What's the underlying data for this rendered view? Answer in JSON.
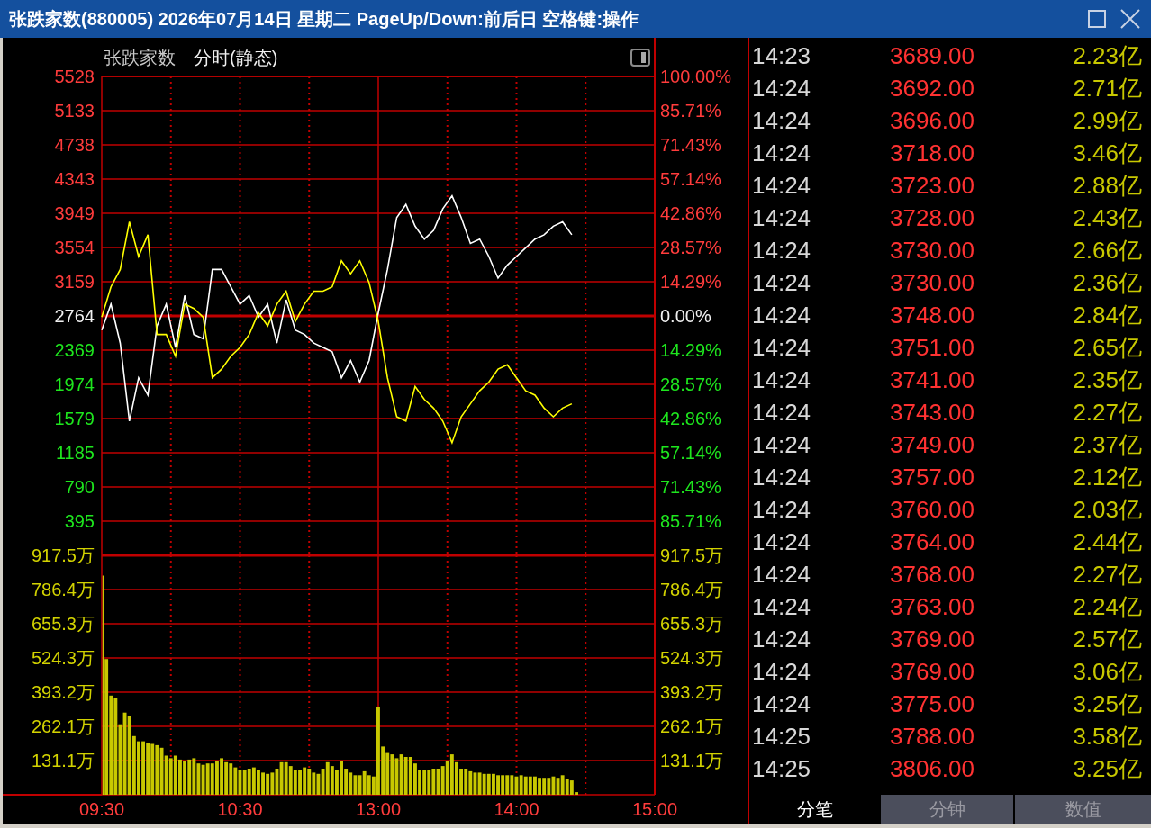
{
  "window": {
    "title": "张跌家数(880005) 2026年07月14日 星期二 PageUp/Down:前后日 空格键:操作"
  },
  "chart_panel": {
    "chart_data": [
      {
        "type": "line",
        "title": "张跌家数",
        "subtitle": "分时(静态)",
        "categories": [
          null,
          null,
          null,
          null,
          null,
          null,
          null,
          null,
          null,
          null,
          null,
          null,
          null,
          null,
          null,
          null,
          null,
          null,
          null,
          null,
          null,
          null,
          null,
          null,
          null,
          null,
          null,
          null,
          null,
          null,
          null,
          null,
          null,
          null,
          null,
          null,
          null,
          null,
          null,
          null,
          null,
          null,
          null,
          null,
          null,
          null,
          null,
          null,
          null,
          null,
          null,
          null,
          null,
          null,
          null,
          null,
          null,
          null,
          null,
          null,
          null
        ],
        "series": [
          {
            "color": "#ffffff",
            "values": [
              2600,
              2900,
              2450,
              1550,
              2050,
              1850,
              2650,
              2900,
              2400,
              3000,
              2550,
              2500,
              3300,
              3300,
              3100,
              2900,
              3000,
              2750,
              2900,
              2450,
              2950,
              2600,
              2550,
              2450,
              2400,
              2350,
              2050,
              2250,
              2000,
              2250,
              2800,
              3300,
              3900,
              4050,
              3800,
              3650,
              3750,
              4000,
              4150,
              3900,
              3600,
              3650,
              3450,
              3200,
              3350,
              3450,
              3550,
              3650,
              3700,
              3800,
              3850,
              3700,
              null,
              null,
              null,
              null,
              null,
              null,
              null,
              null,
              null
            ]
          },
          {
            "color": "#ffff00",
            "values": [
              2750,
              3100,
              3300,
              3850,
              3450,
              3700,
              2550,
              2550,
              2300,
              2900,
              2850,
              2750,
              2050,
              2150,
              2300,
              2400,
              2550,
              2800,
              2650,
              2900,
              3050,
              2700,
              2900,
              3050,
              3050,
              3100,
              3400,
              3250,
              3400,
              3150,
              2700,
              2050,
              1600,
              1550,
              1950,
              1800,
              1700,
              1550,
              1300,
              1600,
              1750,
              1900,
              2000,
              2150,
              2200,
              2050,
              1900,
              1850,
              1700,
              1600,
              1700,
              1750,
              null,
              null,
              null,
              null,
              null,
              null,
              null,
              null,
              null
            ]
          }
        ],
        "ylim": [
          0,
          5528
        ],
        "y2lim": [
          -100,
          100
        ],
        "yticks": [
          5528,
          5133,
          4738,
          4343,
          3949,
          3554,
          3159,
          2764,
          2369,
          1974,
          1579,
          1185,
          790,
          395
        ],
        "y2ticks": [
          {
            "value": 100,
            "label": "100.00%"
          },
          {
            "value": 85.71,
            "label": "85.71%"
          },
          {
            "value": 71.43,
            "label": "71.43%"
          },
          {
            "value": 57.14,
            "label": "57.14%"
          },
          {
            "value": 42.86,
            "label": "42.86%"
          },
          {
            "value": 28.57,
            "label": "28.57%"
          },
          {
            "value": 14.29,
            "label": "14.29%"
          },
          {
            "value": 0,
            "label": "0.00%"
          },
          {
            "value": -14.29,
            "label": "14.29%"
          },
          {
            "value": -28.57,
            "label": "28.57%"
          },
          {
            "value": -42.86,
            "label": "42.86%"
          },
          {
            "value": -57.14,
            "label": "57.14%"
          },
          {
            "value": -71.43,
            "label": "71.43%"
          },
          {
            "value": -85.71,
            "label": "85.71%"
          }
        ],
        "ref_lines": [
          {
            "axis": "y",
            "value": 2764
          }
        ],
        "grid": true
      },
      {
        "type": "bar",
        "categories": [
          "09:30",
          null,
          null,
          null,
          null,
          null,
          null,
          null,
          null,
          null,
          null,
          null,
          null,
          null,
          null,
          null,
          null,
          null,
          null,
          null,
          null,
          null,
          null,
          null,
          null,
          null,
          null,
          null,
          null,
          null,
          "10:30",
          null,
          null,
          null,
          null,
          null,
          null,
          null,
          null,
          null,
          null,
          null,
          null,
          null,
          null,
          null,
          null,
          null,
          null,
          null,
          null,
          null,
          null,
          null,
          null,
          null,
          null,
          null,
          null,
          null,
          "13:00",
          null,
          null,
          null,
          null,
          null,
          null,
          null,
          null,
          null,
          null,
          null,
          null,
          null,
          null,
          null,
          null,
          null,
          null,
          null,
          null,
          null,
          null,
          null,
          null,
          null,
          null,
          null,
          null,
          null,
          "14:00",
          null,
          null,
          null,
          null,
          null,
          null,
          null,
          null,
          null,
          null,
          null,
          null,
          null,
          null,
          null,
          null,
          null,
          null,
          null,
          null,
          null,
          null,
          null,
          null,
          null,
          null,
          null,
          null,
          null,
          "15:00"
        ],
        "values": [
          840,
          520,
          380,
          370,
          270,
          315,
          300,
          225,
          205,
          205,
          200,
          195,
          190,
          180,
          150,
          140,
          150,
          135,
          130,
          135,
          140,
          120,
          115,
          120,
          120,
          130,
          140,
          125,
          120,
          105,
          95,
          95,
          100,
          105,
          95,
          85,
          80,
          85,
          100,
          125,
          125,
          110,
          95,
          95,
          105,
          100,
          85,
          80,
          100,
          125,
          110,
          95,
          130,
          100,
          85,
          75,
          75,
          90,
          75,
          70,
          335,
          185,
          160,
          155,
          140,
          155,
          145,
          145,
          120,
          95,
          95,
          95,
          100,
          100,
          110,
          130,
          155,
          125,
          100,
          100,
          90,
          85,
          85,
          80,
          80,
          80,
          75,
          75,
          75,
          75,
          70,
          75,
          70,
          70,
          70,
          65,
          65,
          65,
          70,
          65,
          75,
          60,
          55,
          10,
          null,
          null,
          null,
          null,
          null,
          null,
          null,
          null,
          null,
          null,
          null,
          null,
          null,
          null,
          null,
          null,
          null
        ],
        "color": "#c8c800",
        "ylim": [
          0,
          917.5
        ],
        "y2lim": [
          0,
          917.5
        ],
        "yticks": [
          {
            "value": 917.5,
            "label": "917.5万"
          },
          {
            "value": 786.4,
            "label": "786.4万"
          },
          {
            "value": 655.3,
            "label": "655.3万"
          },
          {
            "value": 524.3,
            "label": "524.3万"
          },
          {
            "value": 393.2,
            "label": "393.2万"
          },
          {
            "value": 262.1,
            "label": "262.1万"
          },
          {
            "value": 131.1,
            "label": "131.1万"
          }
        ],
        "y2ticks": [
          {
            "value": 917.5,
            "label": "917.5万"
          },
          {
            "value": 786.4,
            "label": "786.4万"
          },
          {
            "value": 655.3,
            "label": "655.3万"
          },
          {
            "value": 524.3,
            "label": "524.3万"
          },
          {
            "value": 393.2,
            "label": "393.2万"
          },
          {
            "value": 262.1,
            "label": "262.1万"
          },
          {
            "value": 131.1,
            "label": "131.1万"
          }
        ],
        "grid": true
      }
    ]
  },
  "trades": {
    "rows": [
      {
        "time": "14:23",
        "price": "3689.00",
        "amount": "2.23亿"
      },
      {
        "time": "14:24",
        "price": "3692.00",
        "amount": "2.71亿"
      },
      {
        "time": "14:24",
        "price": "3696.00",
        "amount": "2.99亿"
      },
      {
        "time": "14:24",
        "price": "3718.00",
        "amount": "3.46亿"
      },
      {
        "time": "14:24",
        "price": "3723.00",
        "amount": "2.88亿"
      },
      {
        "time": "14:24",
        "price": "3728.00",
        "amount": "2.43亿"
      },
      {
        "time": "14:24",
        "price": "3730.00",
        "amount": "2.66亿"
      },
      {
        "time": "14:24",
        "price": "3730.00",
        "amount": "2.36亿"
      },
      {
        "time": "14:24",
        "price": "3748.00",
        "amount": "2.84亿"
      },
      {
        "time": "14:24",
        "price": "3751.00",
        "amount": "2.65亿"
      },
      {
        "time": "14:24",
        "price": "3741.00",
        "amount": "2.35亿"
      },
      {
        "time": "14:24",
        "price": "3743.00",
        "amount": "2.27亿"
      },
      {
        "time": "14:24",
        "price": "3749.00",
        "amount": "2.37亿"
      },
      {
        "time": "14:24",
        "price": "3757.00",
        "amount": "2.12亿"
      },
      {
        "time": "14:24",
        "price": "3760.00",
        "amount": "2.03亿"
      },
      {
        "time": "14:24",
        "price": "3764.00",
        "amount": "2.44亿"
      },
      {
        "time": "14:24",
        "price": "3768.00",
        "amount": "2.27亿"
      },
      {
        "time": "14:24",
        "price": "3763.00",
        "amount": "2.24亿"
      },
      {
        "time": "14:24",
        "price": "3769.00",
        "amount": "2.57亿"
      },
      {
        "time": "14:24",
        "price": "3769.00",
        "amount": "3.06亿"
      },
      {
        "time": "14:24",
        "price": "3775.00",
        "amount": "3.25亿"
      },
      {
        "time": "14:25",
        "price": "3788.00",
        "amount": "3.58亿"
      },
      {
        "time": "14:25",
        "price": "3806.00",
        "amount": "3.25亿"
      }
    ]
  },
  "tabs": [
    {
      "label": "分笔",
      "selected": true
    },
    {
      "label": "分钟",
      "selected": false
    },
    {
      "label": "数值",
      "selected": false
    }
  ]
}
